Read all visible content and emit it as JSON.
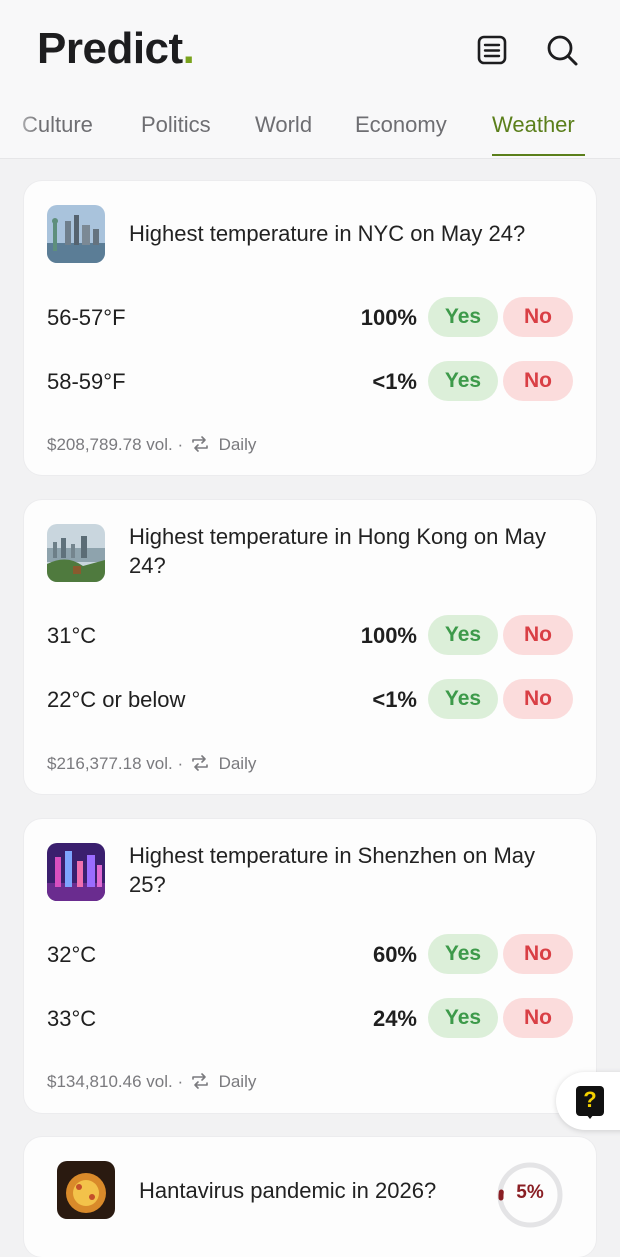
{
  "app": {
    "name": "Predict",
    "dot": "."
  },
  "header": {
    "menu_icon": "list-icon",
    "search_icon": "search-icon"
  },
  "tabs": [
    {
      "label": "Culture",
      "active": false
    },
    {
      "label": "Politics",
      "active": false
    },
    {
      "label": "World",
      "active": false
    },
    {
      "label": "Economy",
      "active": false
    },
    {
      "label": "Weather",
      "active": true
    }
  ],
  "colors": {
    "accent": "#5b7f1b",
    "yes_bg": "#dcefd9",
    "yes_text": "#3d9a4a",
    "no_bg": "#fbdcdc",
    "no_text": "#d93f45"
  },
  "buttons": {
    "yes": "Yes",
    "no": "No"
  },
  "markets": [
    {
      "title": "Highest temperature in NYC on May 24?",
      "outcomes": [
        {
          "label": "56-57°F",
          "pct": "100%"
        },
        {
          "label": "58-59°F",
          "pct": "<1%"
        }
      ],
      "volume": "$208,789.78 vol.",
      "frequency": "Daily"
    },
    {
      "title": "Highest temperature in Hong Kong on May 24?",
      "outcomes": [
        {
          "label": "31°C",
          "pct": "100%"
        },
        {
          "label": "22°C or below",
          "pct": "<1%"
        }
      ],
      "volume": "$216,377.18 vol.",
      "frequency": "Daily"
    },
    {
      "title": "Highest temperature in Shenzhen on May 25?",
      "outcomes": [
        {
          "label": "32°C",
          "pct": "60%"
        },
        {
          "label": "33°C",
          "pct": "24%"
        }
      ],
      "volume": "$134,810.46 vol.",
      "frequency": "Daily"
    },
    {
      "title": "Hantavirus pandemic in 2026?",
      "chance": "5%"
    }
  ],
  "help_button": {
    "label": "?"
  }
}
